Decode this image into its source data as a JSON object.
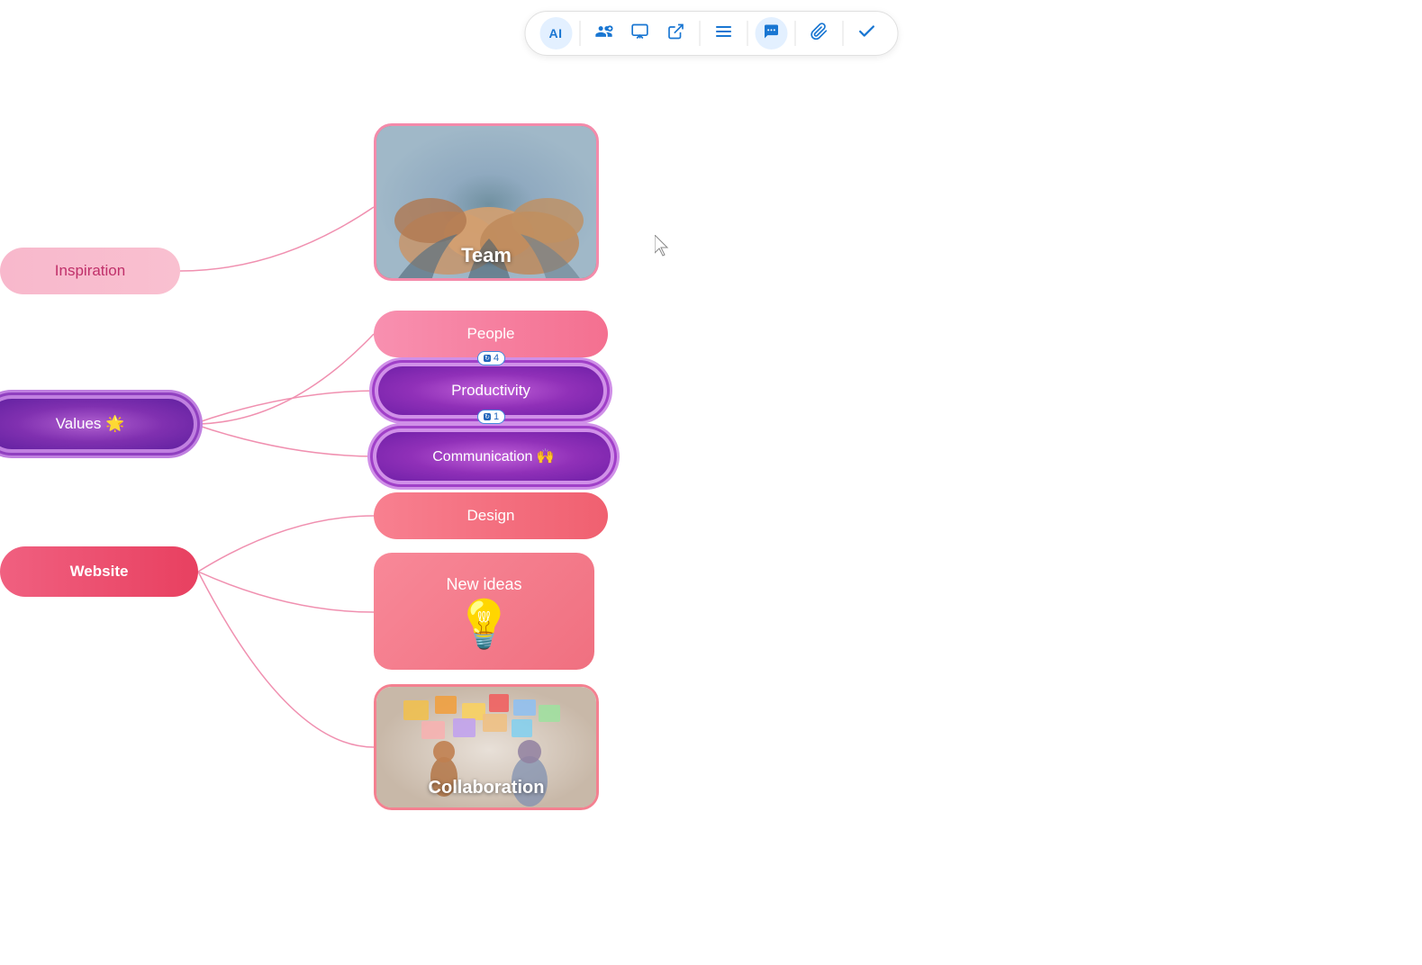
{
  "toolbar": {
    "buttons": [
      {
        "id": "ai",
        "label": "AI",
        "icon": "AI",
        "active": true
      },
      {
        "id": "add-user",
        "label": "Add User",
        "icon": "👤+"
      },
      {
        "id": "presentation",
        "label": "Presentation",
        "icon": "🖥"
      },
      {
        "id": "export",
        "label": "Export",
        "icon": "↗"
      },
      {
        "id": "menu",
        "label": "Menu",
        "icon": "≡"
      },
      {
        "id": "comment",
        "label": "Comment",
        "icon": "💬"
      },
      {
        "id": "attach",
        "label": "Attach",
        "icon": "📎"
      },
      {
        "id": "check",
        "label": "Done",
        "icon": "✓"
      }
    ]
  },
  "nodes": {
    "team": {
      "label": "Team"
    },
    "inspiration": {
      "label": "Inspiration"
    },
    "values": {
      "label": "Values 🌟"
    },
    "website": {
      "label": "Website"
    },
    "people": {
      "label": "People"
    },
    "productivity": {
      "label": "Productivity"
    },
    "communication": {
      "label": "Communication 🙌"
    },
    "design": {
      "label": "Design"
    },
    "newideas": {
      "label": "New ideas",
      "icon": "💡"
    },
    "collaboration": {
      "label": "Collaboration"
    }
  },
  "badges": {
    "people": {
      "count": "4"
    },
    "productivity": {
      "count": "1"
    }
  },
  "colors": {
    "pink_light": "#f890b0",
    "pink_medium": "#f06080",
    "pink_dark": "#e84060",
    "purple": "#9030b8",
    "blue": "#1976d2",
    "white": "#ffffff"
  }
}
